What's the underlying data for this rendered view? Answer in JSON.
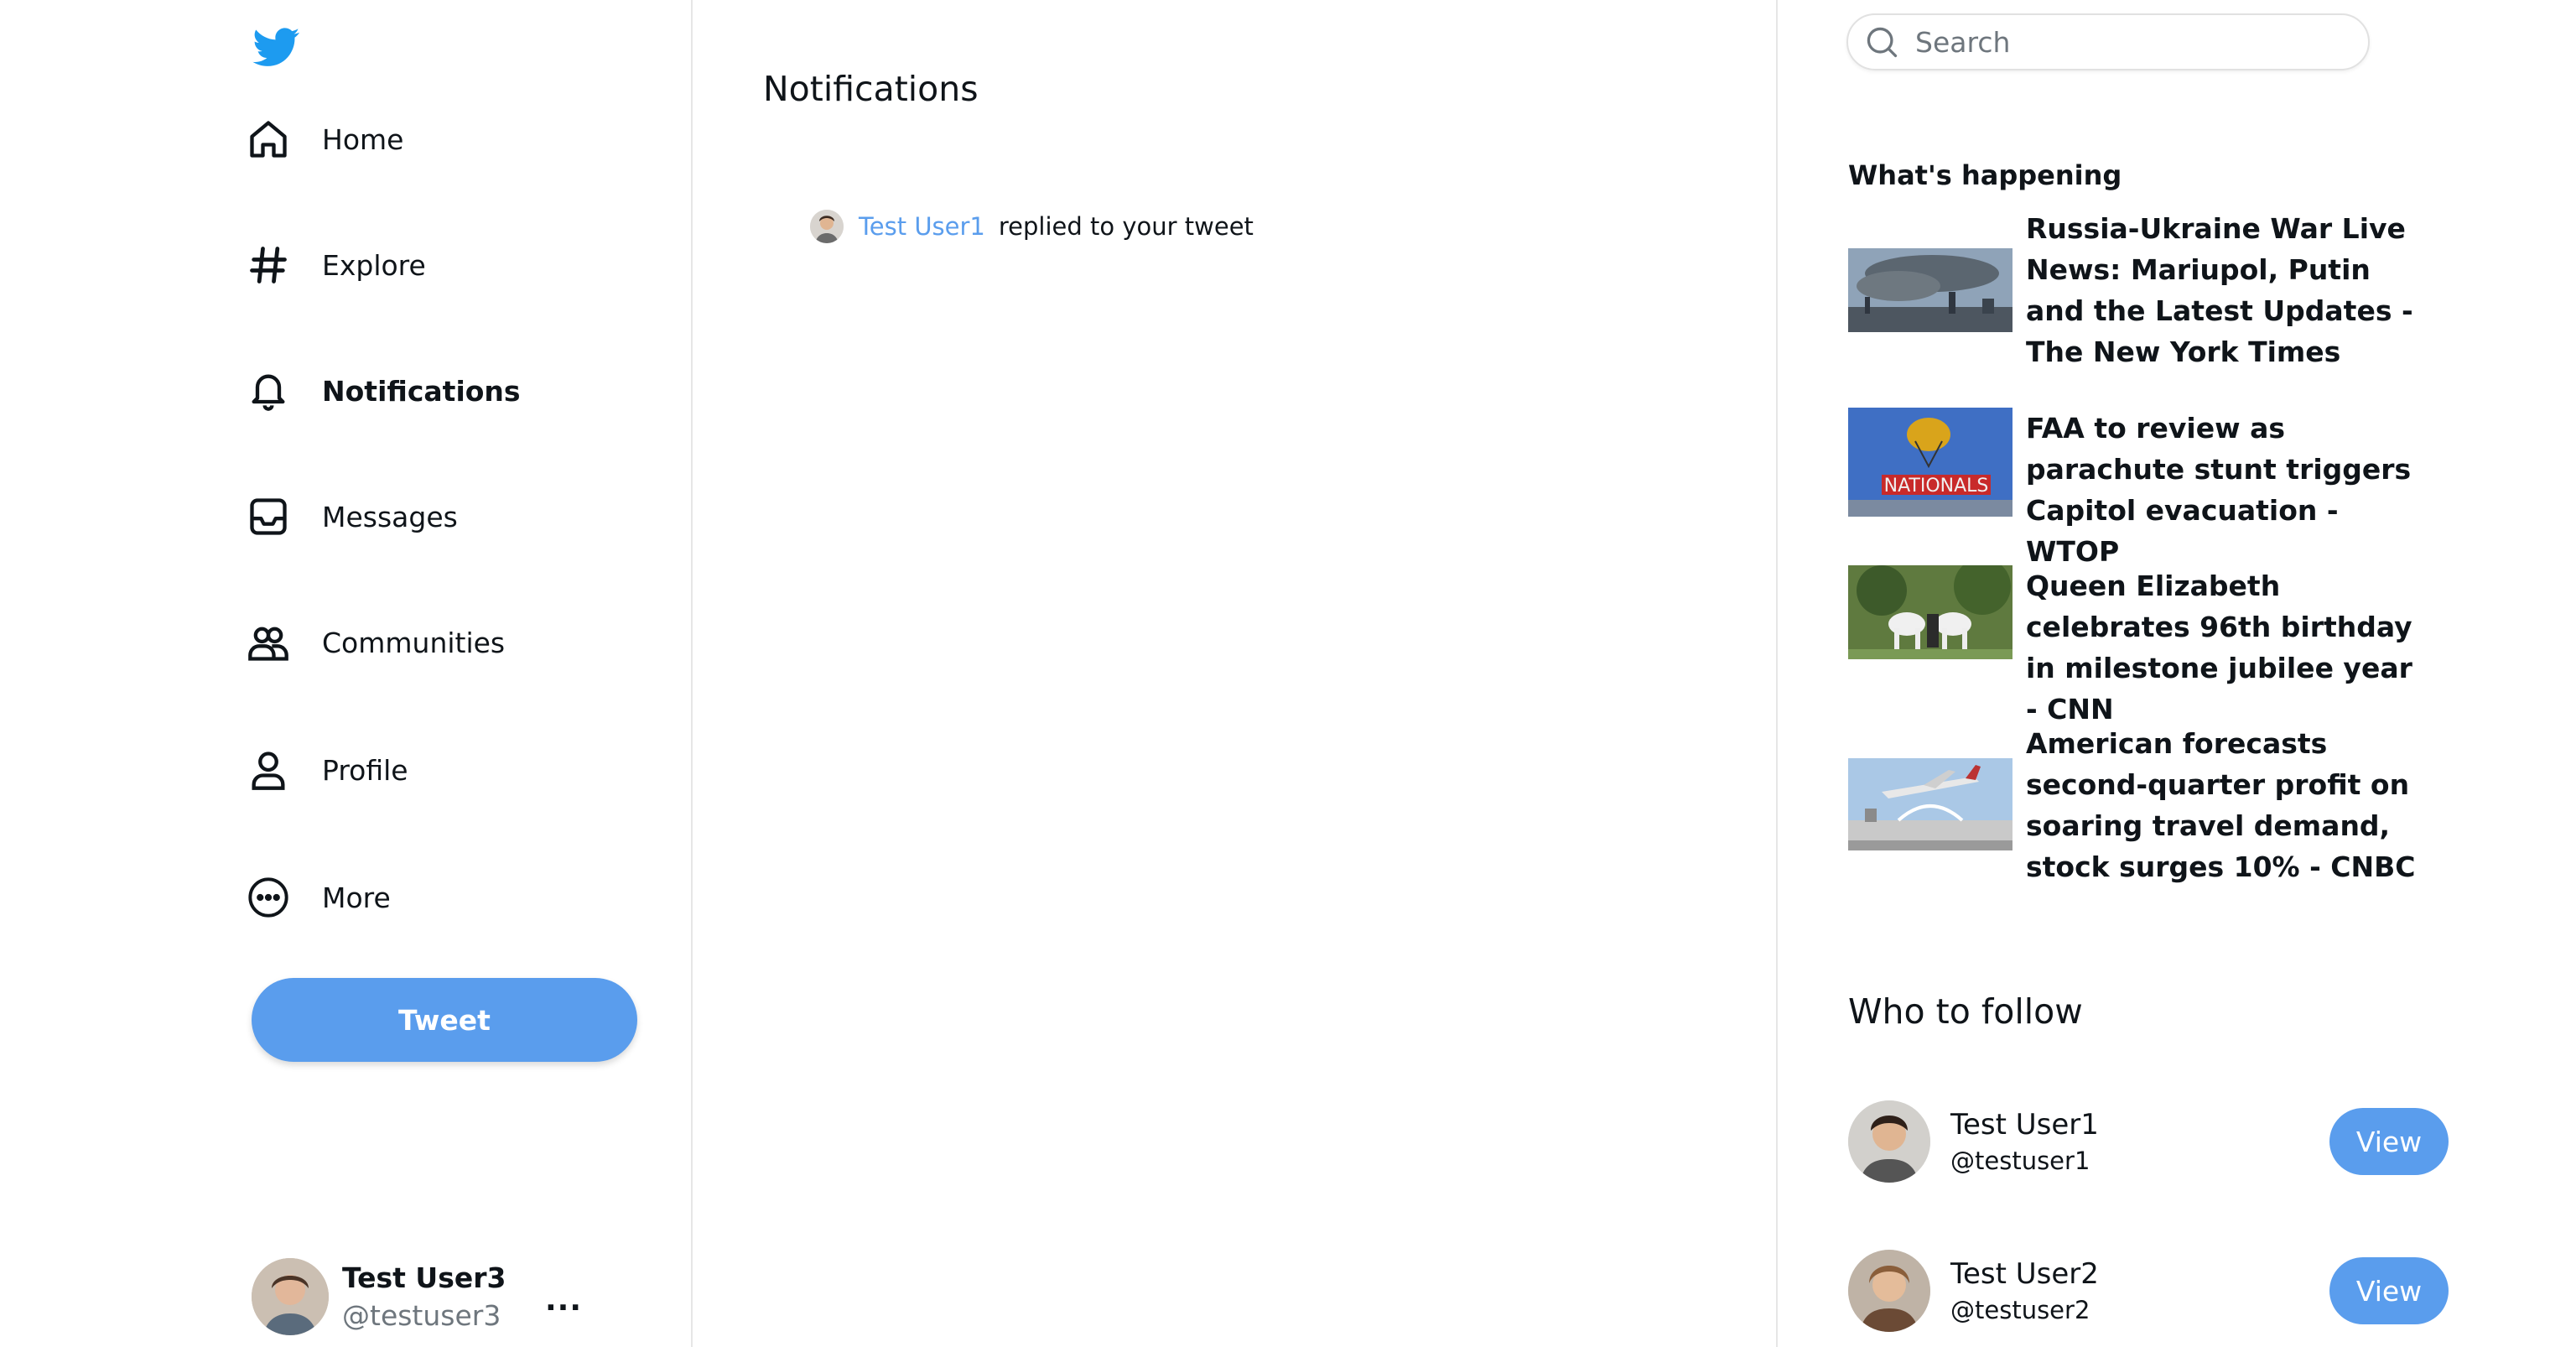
{
  "sidebar": {
    "logo": "twitter-bird-icon",
    "nav": [
      {
        "label": "Home",
        "icon": "home-icon"
      },
      {
        "label": "Explore",
        "icon": "hashtag-icon"
      },
      {
        "label": "Notifications",
        "icon": "bell-icon",
        "active": true
      },
      {
        "label": "Messages",
        "icon": "inbox-icon"
      },
      {
        "label": "Communities",
        "icon": "communities-icon"
      },
      {
        "label": "Profile",
        "icon": "person-icon"
      },
      {
        "label": "More",
        "icon": "more-circle-icon"
      }
    ],
    "tweet_label": "Tweet",
    "account": {
      "name": "Test User3",
      "handle": "@testuser3",
      "more": "..."
    }
  },
  "main": {
    "title": "Notifications",
    "notifications": [
      {
        "user": "Test User1",
        "text": "replied to your tweet"
      }
    ]
  },
  "right": {
    "search": {
      "placeholder": "Search",
      "value": ""
    },
    "happening": {
      "title": "What's happening",
      "items": [
        {
          "headline": "Russia-Ukraine War Live News: Mariupol, Putin and the Latest Updates - The New York Times"
        },
        {
          "headline": "FAA to review as parachute stunt triggers Capitol evacuation - WTOP"
        },
        {
          "headline": "Queen Elizabeth celebrates 96th birthday in milestone jubilee year - CNN"
        },
        {
          "headline": "American forecasts second-quarter profit on soaring travel demand, stock surges 10% - CNBC"
        }
      ]
    },
    "who_to_follow": {
      "title": "Who to follow",
      "users": [
        {
          "name": "Test User1",
          "handle": "@testuser1",
          "button": "View"
        },
        {
          "name": "Test User2",
          "handle": "@testuser2",
          "button": "View"
        }
      ]
    }
  },
  "colors": {
    "accent": "#5a9ded",
    "logo": "#1d9bf0",
    "text": "#0f1419",
    "muted": "#6e767d",
    "divider": "#e6e6e6"
  }
}
